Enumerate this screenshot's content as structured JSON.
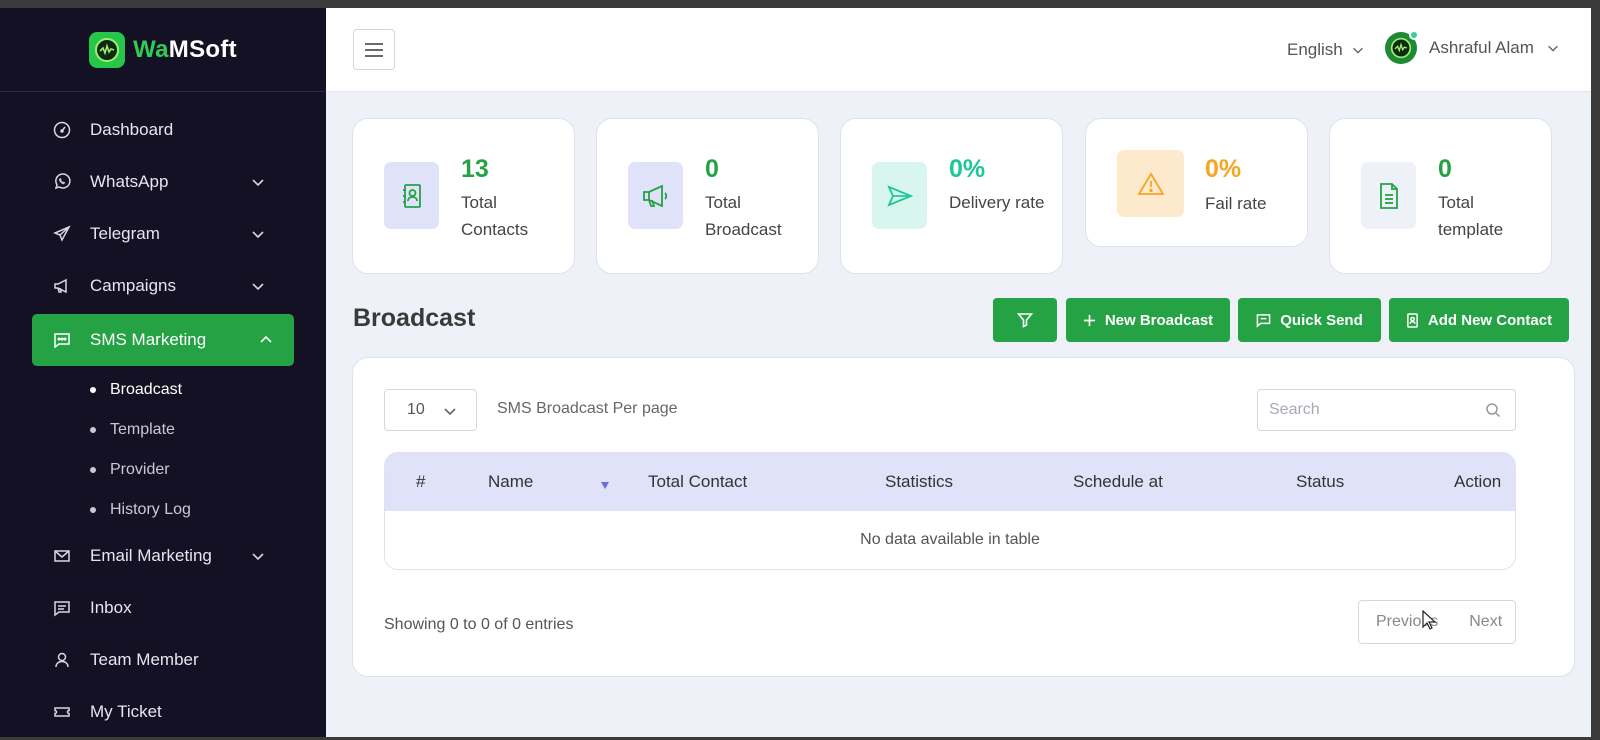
{
  "brand": {
    "prefix": "Wa",
    "suffix": "MSoft"
  },
  "header": {
    "language": "English",
    "user_name": "Ashraful Alam"
  },
  "sidebar": {
    "items": [
      {
        "label": "Dashboard",
        "icon": "gauge-icon"
      },
      {
        "label": "WhatsApp",
        "icon": "whatsapp-icon"
      },
      {
        "label": "Telegram",
        "icon": "telegram-icon"
      },
      {
        "label": "Campaigns",
        "icon": "megaphone-icon"
      },
      {
        "label": "SMS Marketing",
        "icon": "message-icon"
      },
      {
        "label": "Email Marketing",
        "icon": "mail-icon"
      },
      {
        "label": "Inbox",
        "icon": "inbox-icon"
      },
      {
        "label": "Team Member",
        "icon": "user-icon"
      },
      {
        "label": "My Ticket",
        "icon": "ticket-icon"
      }
    ],
    "sms_submenu": [
      "Broadcast",
      "Template",
      "Provider",
      "History Log"
    ]
  },
  "stats": [
    {
      "value": "13",
      "label": "Total Contacts",
      "color": "#25a244"
    },
    {
      "value": "0",
      "label": "Total Broadcast",
      "color": "#25a244"
    },
    {
      "value": "0%",
      "label": "Delivery rate",
      "color": "#1ec79a"
    },
    {
      "value": "0%",
      "label": "Fail rate",
      "color": "#f5a623"
    },
    {
      "value": "0",
      "label": "Total template",
      "color": "#25a244"
    }
  ],
  "section": {
    "title": "Broadcast"
  },
  "buttons": {
    "new_broadcast": "New Broadcast",
    "quick_send": "Quick Send",
    "add_contact": "Add New Contact"
  },
  "table": {
    "per_page_value": "10",
    "per_page_label": "SMS Broadcast Per page",
    "search_placeholder": "Search",
    "columns": [
      "#",
      "Name",
      "Total Contact",
      "Statistics",
      "Schedule at",
      "Status",
      "Action"
    ],
    "empty_message": "No data available in table",
    "showing": "Showing 0 to 0 of 0 entries",
    "prev": "Previous",
    "next": "Next"
  },
  "colors": {
    "accent": "#25a244",
    "sidebar_bg": "#141125",
    "table_header_bg": "#dfe2f8"
  }
}
